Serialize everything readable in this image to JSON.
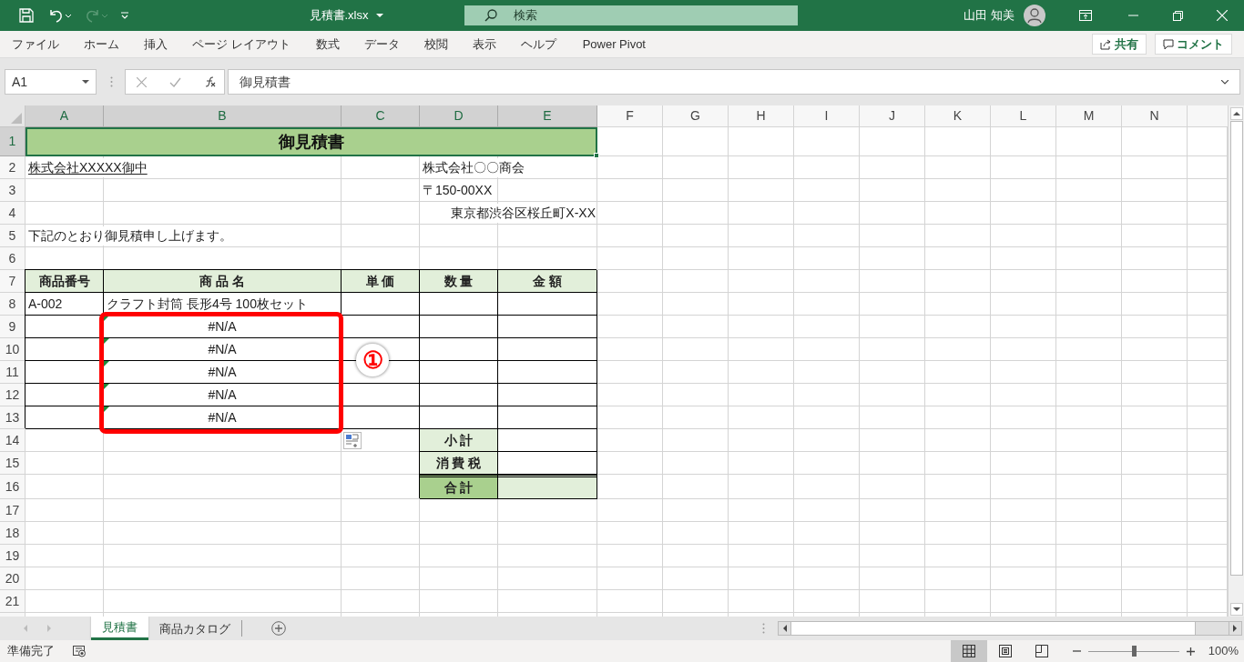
{
  "title_bar": {
    "file_name": "見積書.xlsx",
    "search_placeholder": "検索",
    "user_name": "山田 知美"
  },
  "ribbon_tabs": [
    "ファイル",
    "ホーム",
    "挿入",
    "ページ レイアウト",
    "数式",
    "データ",
    "校閲",
    "表示",
    "ヘルプ",
    "Power Pivot"
  ],
  "share_button": "共有",
  "comment_button": "コメント",
  "name_box": "A1",
  "formula": "御見積書",
  "columns": [
    {
      "label": "A",
      "selected": true
    },
    {
      "label": "B",
      "selected": true
    },
    {
      "label": "C",
      "selected": true
    },
    {
      "label": "D",
      "selected": true
    },
    {
      "label": "E",
      "selected": true
    },
    {
      "label": "F",
      "selected": false
    },
    {
      "label": "G",
      "selected": false
    },
    {
      "label": "H",
      "selected": false
    },
    {
      "label": "I",
      "selected": false
    },
    {
      "label": "J",
      "selected": false
    },
    {
      "label": "K",
      "selected": false
    },
    {
      "label": "L",
      "selected": false
    },
    {
      "label": "M",
      "selected": false
    },
    {
      "label": "N",
      "selected": false
    }
  ],
  "rows": [
    {
      "number": "1",
      "selected": true,
      "cells": [
        {
          "kind": "title",
          "text": "御見積書"
        }
      ]
    },
    {
      "number": "2",
      "selected": false,
      "cells": [
        {
          "kind": "underlined",
          "text": "株式会社XXXXX御中"
        },
        {
          "kind": "plain"
        },
        {
          "kind": "plain"
        },
        {
          "kind": "plain",
          "text": "株式会社〇〇商会"
        },
        {
          "kind": "plain"
        }
      ]
    },
    {
      "number": "3",
      "selected": false,
      "cells": [
        {
          "kind": "plain"
        },
        {
          "kind": "plain"
        },
        {
          "kind": "plain"
        },
        {
          "kind": "plain",
          "text": "〒150-00XX"
        },
        {
          "kind": "plain"
        }
      ]
    },
    {
      "number": "4",
      "selected": false,
      "cells": [
        {
          "kind": "plain"
        },
        {
          "kind": "plain"
        },
        {
          "kind": "plain"
        },
        {
          "kind": "plain"
        },
        {
          "kind": "plain_right",
          "text": "東京都渋谷区桜丘町X-XX"
        }
      ]
    },
    {
      "number": "5",
      "selected": false,
      "cells": [
        {
          "kind": "plain",
          "text": "下記のとおり御見積申し上げます。"
        },
        {
          "kind": "plain"
        },
        {
          "kind": "plain"
        },
        {
          "kind": "plain"
        },
        {
          "kind": "plain"
        }
      ]
    },
    {
      "number": "6",
      "selected": false
    },
    {
      "number": "7",
      "selected": false,
      "cells": [
        {
          "kind": "header",
          "text": "商品番号"
        },
        {
          "kind": "header",
          "text": "商 品 名"
        },
        {
          "kind": "header",
          "text": "単 価"
        },
        {
          "kind": "header",
          "text": "数 量"
        },
        {
          "kind": "header",
          "text": "金 額"
        }
      ]
    },
    {
      "number": "8",
      "selected": false,
      "cells": [
        {
          "kind": "boxed",
          "text": "A-002"
        },
        {
          "kind": "boxed",
          "text": "クラフト封筒 長形4号 100枚セット"
        },
        {
          "kind": "boxed"
        },
        {
          "kind": "boxed"
        },
        {
          "kind": "boxed"
        }
      ]
    },
    {
      "number": "9",
      "selected": false,
      "cells": [
        {
          "kind": "boxed"
        },
        {
          "kind": "error",
          "text": "#N/A"
        },
        {
          "kind": "boxed"
        },
        {
          "kind": "boxed"
        },
        {
          "kind": "boxed"
        }
      ]
    },
    {
      "number": "10",
      "selected": false,
      "cells": [
        {
          "kind": "boxed"
        },
        {
          "kind": "error",
          "text": "#N/A"
        },
        {
          "kind": "boxed"
        },
        {
          "kind": "boxed"
        },
        {
          "kind": "boxed"
        }
      ]
    },
    {
      "number": "11",
      "selected": false,
      "cells": [
        {
          "kind": "boxed"
        },
        {
          "kind": "error",
          "text": "#N/A"
        },
        {
          "kind": "boxed"
        },
        {
          "kind": "boxed"
        },
        {
          "kind": "boxed"
        }
      ]
    },
    {
      "number": "12",
      "selected": false,
      "cells": [
        {
          "kind": "boxed"
        },
        {
          "kind": "error",
          "text": "#N/A"
        },
        {
          "kind": "boxed"
        },
        {
          "kind": "boxed"
        },
        {
          "kind": "boxed"
        }
      ]
    },
    {
      "number": "13",
      "selected": false,
      "cells": [
        {
          "kind": "boxed"
        },
        {
          "kind": "error",
          "text": "#N/A"
        },
        {
          "kind": "boxed"
        },
        {
          "kind": "boxed"
        },
        {
          "kind": "boxed"
        }
      ]
    },
    {
      "number": "14",
      "selected": false,
      "cells": [
        {
          "kind": "plain"
        },
        {
          "kind": "plain"
        },
        {
          "kind": "plain"
        },
        {
          "kind": "label",
          "text": "小 計"
        },
        {
          "kind": "boxed"
        }
      ]
    },
    {
      "number": "15",
      "selected": false,
      "cells": [
        {
          "kind": "plain"
        },
        {
          "kind": "plain"
        },
        {
          "kind": "plain"
        },
        {
          "kind": "label",
          "text": "消 費 税"
        },
        {
          "kind": "boxed"
        }
      ]
    },
    {
      "number": "16",
      "selected": false,
      "cells": [
        {
          "kind": "plain"
        },
        {
          "kind": "plain"
        },
        {
          "kind": "plain"
        },
        {
          "kind": "total_label",
          "text": "合 計"
        },
        {
          "kind": "total_value"
        }
      ]
    },
    {
      "number": "17",
      "selected": false
    },
    {
      "number": "18",
      "selected": false
    },
    {
      "number": "19",
      "selected": false
    },
    {
      "number": "20",
      "selected": false
    },
    {
      "number": "21",
      "selected": false
    }
  ],
  "annotation": {
    "label": "①"
  },
  "sheet_tabs": [
    {
      "label": "見積書",
      "selected": true
    },
    {
      "label": "商品カタログ",
      "selected": false
    }
  ],
  "status_bar": {
    "text": "準備完了",
    "views": [
      {
        "kind": "normal",
        "selected": true
      },
      {
        "kind": "page_layout",
        "selected": false
      },
      {
        "kind": "page_break",
        "selected": false
      }
    ],
    "zoom": {
      "level": 0.5,
      "reading": "100%"
    }
  }
}
